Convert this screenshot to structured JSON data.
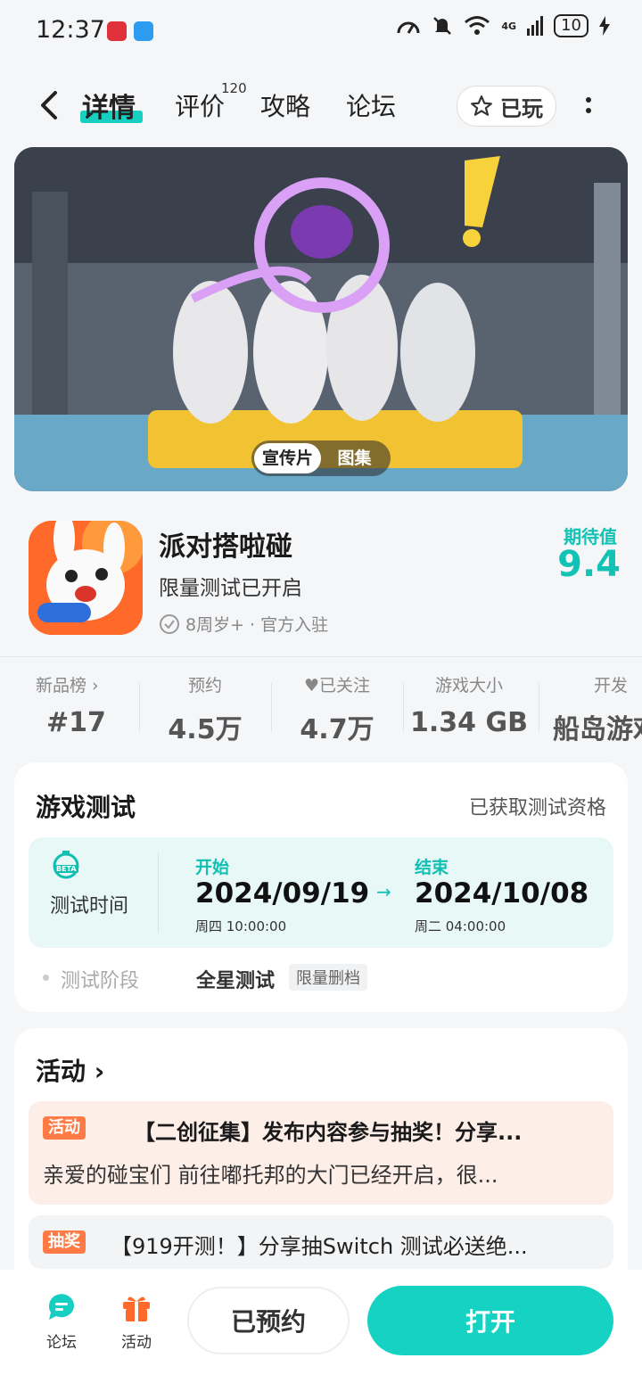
{
  "status": {
    "time": "12:37",
    "battery": "10",
    "network": "4G"
  },
  "nav": {
    "tabs": [
      {
        "label": "详情"
      },
      {
        "label": "评价",
        "badge": "120"
      },
      {
        "label": "攻略"
      },
      {
        "label": "论坛"
      }
    ],
    "played_label": "已玩"
  },
  "banner": {
    "seg": [
      "宣传片",
      "图集"
    ]
  },
  "app": {
    "name": "派对搭啦碰",
    "subtitle": "限量测试已开启",
    "meta": "8周岁+ · 官方入驻",
    "expect_label": "期待值",
    "expect_value": "9.4"
  },
  "stats": [
    {
      "label": "新品榜 ›",
      "value": "#17"
    },
    {
      "label": "预约",
      "value": "4.5万"
    },
    {
      "label": "♥已关注",
      "value": "4.7万"
    },
    {
      "label": "游戏大小",
      "value": "1.34 GB"
    },
    {
      "label": "开发",
      "value": "船岛游戏"
    }
  ],
  "test": {
    "title": "游戏测试",
    "status": "已获取测试资格",
    "beta_badge": "BETA",
    "time_label": "测试时间",
    "start_label": "开始",
    "start_date": "2024/09/19",
    "start_time": "周四  10:00:00",
    "arrow": "→",
    "end_label": "结束",
    "end_date": "2024/10/08",
    "end_time": "周二  04:00:00",
    "phase_label": "测试阶段",
    "phase_value": "全星测试",
    "phase_tag": "限量删档"
  },
  "activity": {
    "title": "活动 ›",
    "items": [
      {
        "tag": "活动",
        "title": "【二创征集】发布内容参与抽奖！分享...",
        "desc": "亲爱的碰宝们 前往嘟托邦的大门已经开启，很..."
      },
      {
        "tag": "抽奖",
        "title": "【919开测！】分享抽Switch 测试必送绝..."
      }
    ]
  },
  "bottom": {
    "forum_label": "论坛",
    "activity_label": "活动",
    "reserved_label": "已预约",
    "open_label": "打开"
  },
  "colors": {
    "accent": "#16d2c2",
    "orange": "#ff7a45"
  }
}
